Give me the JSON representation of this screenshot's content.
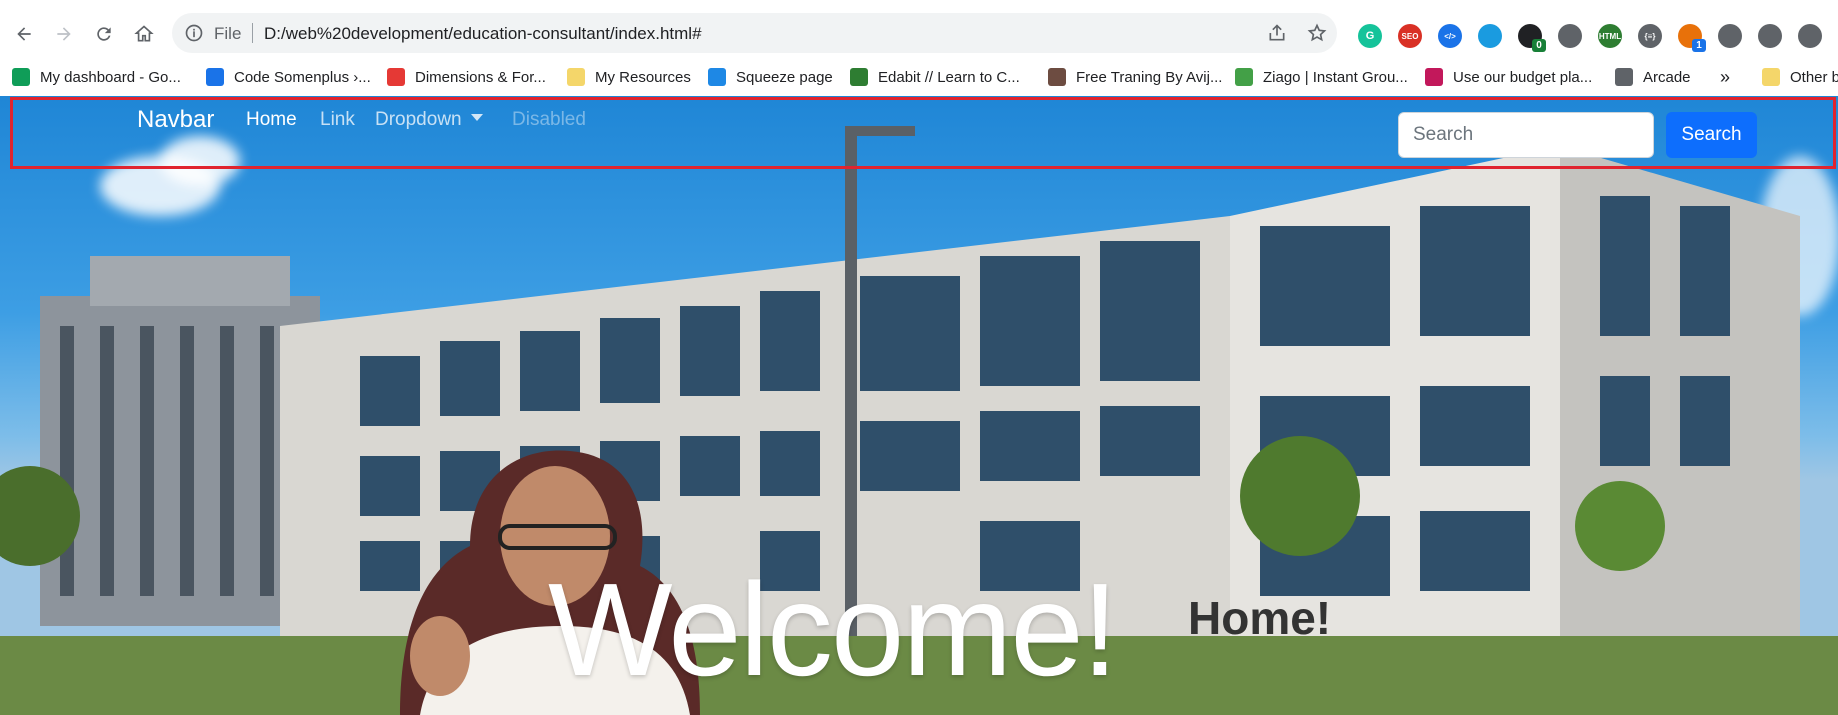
{
  "browser": {
    "omnibox": {
      "scheme_label": "File",
      "url": "D:/web%20development/education-consultant/index.html#"
    },
    "extensions": [
      {
        "icon": "grammarly-icon",
        "label": "G",
        "color": "#15c39a"
      },
      {
        "icon": "seo-icon",
        "label": "SEO",
        "color": "#d93025"
      },
      {
        "icon": "code-tag-icon",
        "label": "</>",
        "color": "#1a73e8"
      },
      {
        "icon": "window-resize-icon",
        "label": "",
        "color": "#1a9be0"
      },
      {
        "icon": "key-icon",
        "label": "",
        "color": "#202124",
        "badge": "0"
      },
      {
        "icon": "bug-icon",
        "label": "",
        "color": "#5f6368"
      },
      {
        "icon": "html-tree-icon",
        "label": "HTML",
        "color": "#2e7d32"
      },
      {
        "icon": "json-icon",
        "label": "{≡}",
        "color": "#5f6368"
      },
      {
        "icon": "colorpick-icon",
        "label": "",
        "color": "#e8710a",
        "badge": "1"
      },
      {
        "icon": "puzzle-icon",
        "label": "",
        "color": "#5f6368"
      },
      {
        "icon": "reading-list-icon",
        "label": "",
        "color": "#5f6368"
      },
      {
        "icon": "side-panel-icon",
        "label": "",
        "color": "#5f6368"
      }
    ],
    "bookmarks": [
      {
        "label": "My dashboard - Go...",
        "icon": "sheets-icon",
        "color": "#0f9d58"
      },
      {
        "label": "Code Somenplus ›...",
        "icon": "accessibility-icon",
        "color": "#1a73e8"
      },
      {
        "label": "Dimensions & For...",
        "icon": "dimensions-icon",
        "color": "#e53935"
      },
      {
        "label": "My Resources",
        "icon": "folder-icon",
        "color": "#f4d66a"
      },
      {
        "label": "Squeeze page",
        "icon": "s-icon",
        "color": "#1e88e5"
      },
      {
        "label": "Edabit // Learn to C...",
        "icon": "edabit-icon",
        "color": "#2e7d32"
      },
      {
        "label": "Free Traning By Avij...",
        "icon": "person-icon",
        "color": "#6d4c41"
      },
      {
        "label": "Ziago | Instant Grou...",
        "icon": "ziago-icon",
        "color": "#43a047"
      },
      {
        "label": "Use our budget pla...",
        "icon": "budget-icon",
        "color": "#c2185b"
      },
      {
        "label": "Arcade",
        "icon": "globe-icon",
        "color": "#5f6368"
      }
    ],
    "overflow_label": "»",
    "other_bookmarks_label": "Other b"
  },
  "page": {
    "navbar": {
      "brand": "Navbar",
      "links": [
        {
          "label": "Home",
          "state": "active"
        },
        {
          "label": "Link",
          "state": "normal"
        },
        {
          "label": "Dropdown",
          "state": "dropdown"
        },
        {
          "label": "Disabled",
          "state": "disabled"
        }
      ],
      "search_placeholder": "Search",
      "search_button": "Search"
    },
    "hero": {
      "heading": "Welcome!",
      "subheading": "Home!"
    }
  }
}
